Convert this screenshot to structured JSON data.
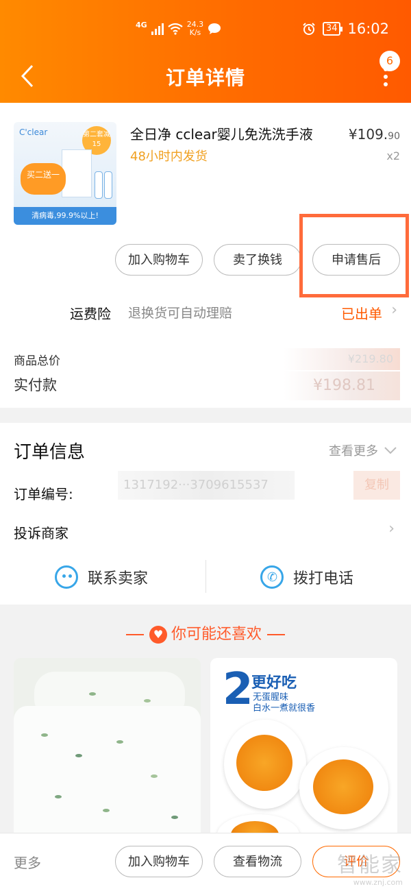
{
  "status_bar": {
    "network": "4G",
    "speed_value": "24.3",
    "speed_unit": "K/s",
    "battery": "34",
    "time": "16:02"
  },
  "nav": {
    "title": "订单详情",
    "back_icon": "chevron-left-icon",
    "more_icon": "more-vertical-icon",
    "badge_count": "6"
  },
  "product": {
    "image_logo": "C'clear",
    "image_promo": "第二套减15",
    "image_blob": "买二送一",
    "image_strip": "清病毒,99.9%以上!",
    "title": "全日净 cclear婴儿免洗洗手液",
    "shipping": "48小时内发货",
    "price_main": "¥109.",
    "price_decimal": "90",
    "quantity": "x2",
    "buttons": [
      "加入购物车",
      "卖了换钱",
      "申请售后"
    ]
  },
  "insurance": {
    "label": "运费险",
    "desc": "退换货可自动理赔",
    "status": "已出单"
  },
  "summary": {
    "total_label": "商品总价",
    "total_value": "¥219.80",
    "paid_label": "实付款",
    "paid_value": "¥198.81"
  },
  "order_info": {
    "title": "订单信息",
    "more": "查看更多",
    "number_label": "订单编号:",
    "number_value": "1317192···3709615537",
    "copy": "复制",
    "complain": "投诉商家",
    "contact_seller": "联系卖家",
    "call_phone": "拨打电话"
  },
  "recommend": {
    "title": "你可能还喜欢",
    "item2_num": "2",
    "item2_title": "更好吃",
    "item2_sub1": "无蛋腥味",
    "item2_sub2": "白水一煮就很香"
  },
  "bottom_bar": {
    "more": "更多",
    "add_cart": "加入购物车",
    "logistics": "查看物流",
    "review": "评价"
  },
  "watermark": {
    "line1": "智能家",
    "line2": "www.znj.com"
  },
  "colors": {
    "brand": "#ff6a00",
    "accent_red": "#ff5a2a",
    "highlight_box": "#ff6b3b",
    "shipping_text": "#f0a020",
    "contact_icon": "#38a6e8"
  }
}
